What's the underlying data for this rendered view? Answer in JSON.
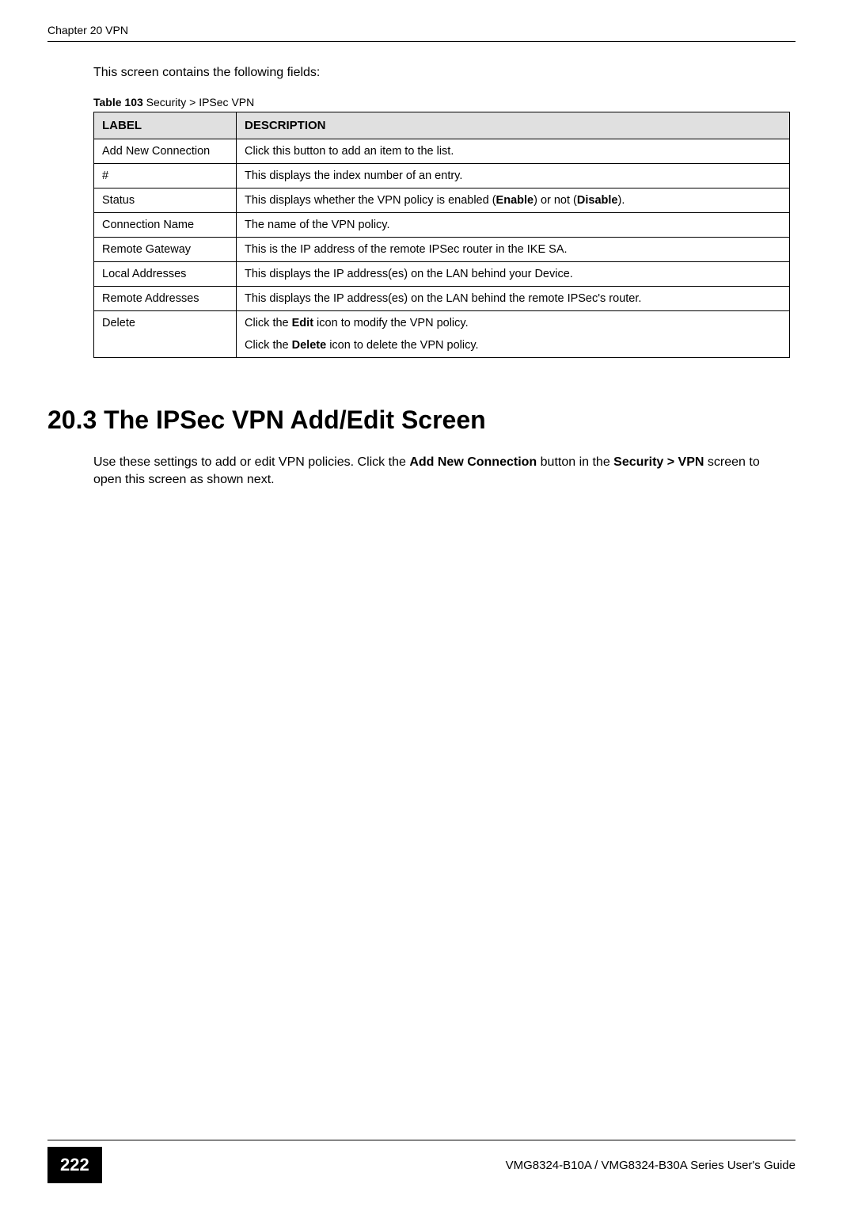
{
  "chapter_header": "Chapter 20 VPN",
  "intro_text": "This screen contains the following fields:",
  "table_caption_prefix": "Table 103",
  "table_caption_text": "   Security >  IPSec VPN",
  "table_headers": {
    "label": "LABEL",
    "description": "DESCRIPTION"
  },
  "table_rows": [
    {
      "label": "Add New Connection",
      "description": "Click this button to add an item  to the list."
    },
    {
      "label": "#",
      "description": "This displays the index number of an entry."
    },
    {
      "label": "Status",
      "description_parts": [
        "This displays whether the VPN policy is enabled (",
        "Enable",
        ") or not (",
        "Disable",
        ")."
      ]
    },
    {
      "label": "Connection Name",
      "description": "The name of the VPN policy."
    },
    {
      "label": "Remote Gateway",
      "description": "This is the IP address of the remote IPSec router in the IKE SA."
    },
    {
      "label": "Local Addresses",
      "description": "This displays the IP address(es) on the LAN behind your Device."
    },
    {
      "label": "Remote Addresses",
      "description": "This displays the IP address(es) on the LAN behind the remote IPSec's router."
    },
    {
      "label": "Delete",
      "description_lines": [
        {
          "parts": [
            "Click the ",
            "Edit",
            " icon to modify the VPN policy."
          ]
        },
        {
          "parts": [
            "Click the ",
            "Delete",
            " icon to delete the VPN policy."
          ]
        }
      ]
    }
  ],
  "section_heading": "20.3  The IPSec VPN Add/Edit Screen",
  "section_body_parts": [
    "Use these settings to add or edit VPN policies. Click the ",
    "Add New Connection",
    " button in the ",
    "Security >  VPN",
    " screen to open this screen as shown next."
  ],
  "footer": {
    "page_number": "222",
    "guide_text": "VMG8324-B10A / VMG8324-B30A Series User's Guide"
  }
}
